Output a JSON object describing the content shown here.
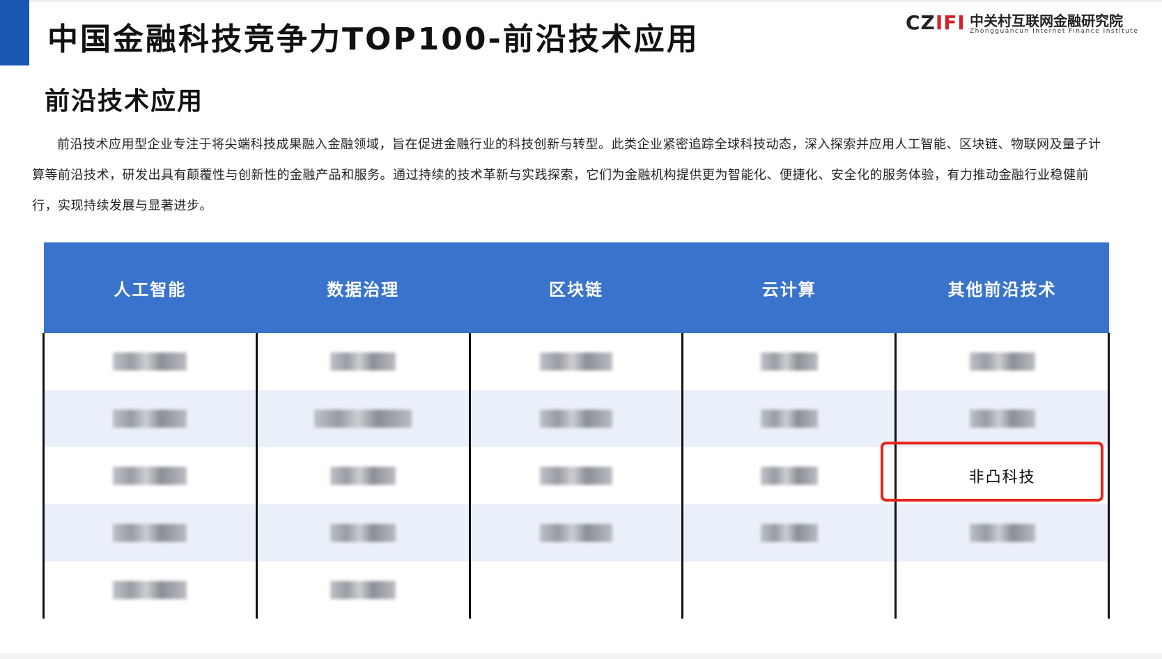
{
  "header": {
    "title": "中国金融科技竞争力TOP100-前沿技术应用"
  },
  "logo": {
    "mark_dark": "CZ",
    "mark_red": "IFI",
    "name_cn": "中关村互联网金融研究院",
    "name_en": "Zhongguancun Internet Finance Institute"
  },
  "section": {
    "title": "前沿技术应用",
    "intro": "前沿技术应用型企业专注于将尖端科技成果融入金融领域，旨在促进金融行业的科技创新与转型。此类企业紧密追踪全球科技动态，深入探索并应用人工智能、区块链、物联网及量子计算等前沿技术，研发出具有颠覆性与创新性的金融产品和服务。通过持续的技术革新与实践探索，它们为金融机构提供更为智能化、便捷化、安全化的服务体验，有力推动金融行业稳健前行，实现持续发展与显著进步。"
  },
  "table": {
    "columns": [
      "人工智能",
      "数据治理",
      "区块链",
      "云计算",
      "其他前沿技术"
    ],
    "highlighted_cell": "非凸科技"
  },
  "colors": {
    "brand_blue": "#1957b3",
    "header_blue": "#3a73cc",
    "highlight_red": "#e8231b",
    "row_alt": "#eaf0fa"
  }
}
